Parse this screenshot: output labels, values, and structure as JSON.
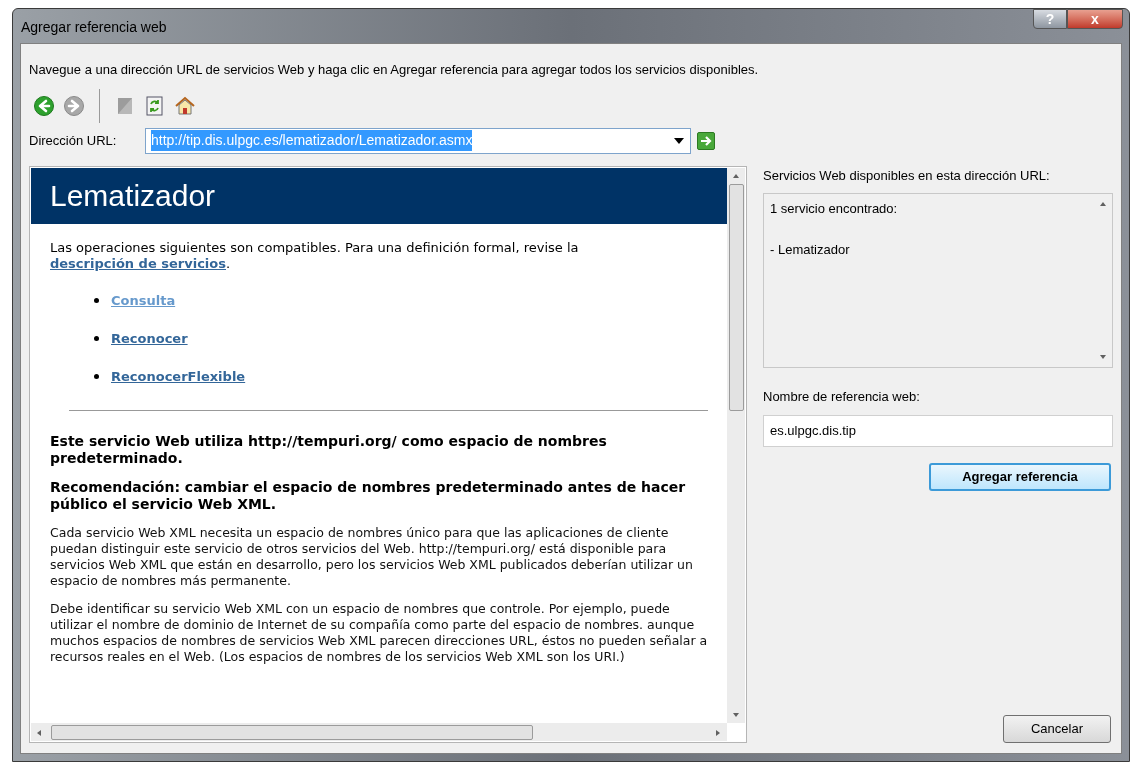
{
  "window": {
    "title": "Agregar referencia web",
    "buttons": [
      {
        "kind": "help",
        "label": "?"
      },
      {
        "kind": "close",
        "label": "x"
      }
    ]
  },
  "instructions": "Navegue a una dirección URL de servicios Web y haga clic en Agregar referencia para agregar todos los servicios disponibles.",
  "toolbar": [
    {
      "kind": "back",
      "disabled": false
    },
    {
      "kind": "forward",
      "disabled": true
    },
    {
      "kind": "separator"
    },
    {
      "kind": "stop",
      "disabled": true
    },
    {
      "kind": "refresh",
      "disabled": false
    },
    {
      "kind": "home",
      "disabled": false
    }
  ],
  "address": {
    "label": "Dirección URL:",
    "value": "http://tip.dis.ulpgc.es/lematizador/Lematizador.asmx",
    "text_selected": true
  },
  "browser": {
    "heading": "Lematizador",
    "intro": {
      "text": "Las operaciones siguientes son compatibles. Para una definición formal, revise la",
      "link": "descripción de servicios",
      "after": "."
    },
    "operations": [
      {
        "label": "Consulta",
        "visited": true
      },
      {
        "label": "Reconocer",
        "visited": false
      },
      {
        "label": "ReconocerFlexible",
        "visited": false
      }
    ],
    "notice": "Este servicio Web utiliza http://tempuri.org/ como espacio de nombres predeterminado.",
    "recommendation": "Recomendación: cambiar el espacio de nombres predeterminado antes de hacer público el servicio Web XML.",
    "paragraphs": [
      "Cada servicio Web XML necesita un espacio de nombres único para que las aplicaciones de cliente puedan distinguir este servicio de otros servicios del Web. http://tempuri.org/ está disponible para servicios Web XML que están en desarrollo, pero los servicios Web XML publicados deberían utilizar un espacio de nombres más permanente.",
      "Debe identificar su servicio Web XML con un espacio de nombres que controle. Por ejemplo, puede utilizar el nombre de dominio de Internet de su compañía como parte del espacio de nombres. aunque muchos espacios de nombres de servicios Web XML parecen direcciones URL, éstos no pueden señalar a recursos reales en el Web. (Los espacios de nombres de los servicios Web XML son los URI.)"
    ]
  },
  "services": {
    "label": "Servicios Web disponibles en esta dirección URL:",
    "lines": [
      "1 servicio encontrado:",
      "- Lematizador"
    ]
  },
  "reference_name": {
    "label": "Nombre de referencia web:",
    "value": "es.ulpgc.dis.tip"
  },
  "add_button": {
    "label": "Agregar referencia",
    "default": true
  },
  "cancel_button": {
    "label": "Cancelar"
  }
}
